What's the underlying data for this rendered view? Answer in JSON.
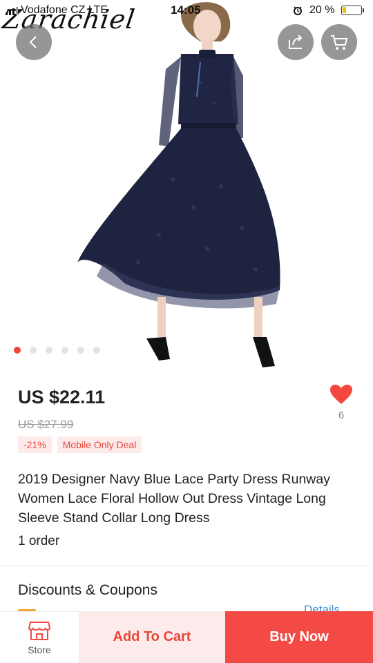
{
  "status_bar": {
    "carrier": "Vodafone CZ  LTE",
    "time": "14:05",
    "battery_percent_label": "20 %",
    "battery_level": 0.2
  },
  "hero": {
    "brand_watermark": "Zarachiel",
    "carousel": {
      "count": 6,
      "active_index": 0
    }
  },
  "icons": {
    "back": "chevron-left-icon",
    "share": "share-icon",
    "cart": "cart-icon",
    "wishlist": "heart-icon",
    "store": "store-icon",
    "alarm": "alarm-icon"
  },
  "product": {
    "price": "US $22.11",
    "original_price": "US $27.99",
    "discount_tag": "-21%",
    "deal_tag": "Mobile Only Deal",
    "wishlist_count": "6",
    "title": "2019 Designer Navy Blue Lace Party Dress Runway Women Lace Floral Hollow Out Dress Vintage Long Sleeve Stand Collar Long Dress",
    "orders": "1 order"
  },
  "discounts": {
    "heading": "Discounts & Coupons",
    "details_link": "Details"
  },
  "bottom_bar": {
    "store_label": "Store",
    "add_to_cart_label": "Add To Cart",
    "buy_now_label": "Buy Now"
  },
  "colors": {
    "accent_red": "#f44a45",
    "tag_bg": "#fdeaea",
    "link_blue": "#3f8ed8",
    "dress_navy": "#1e2440"
  }
}
